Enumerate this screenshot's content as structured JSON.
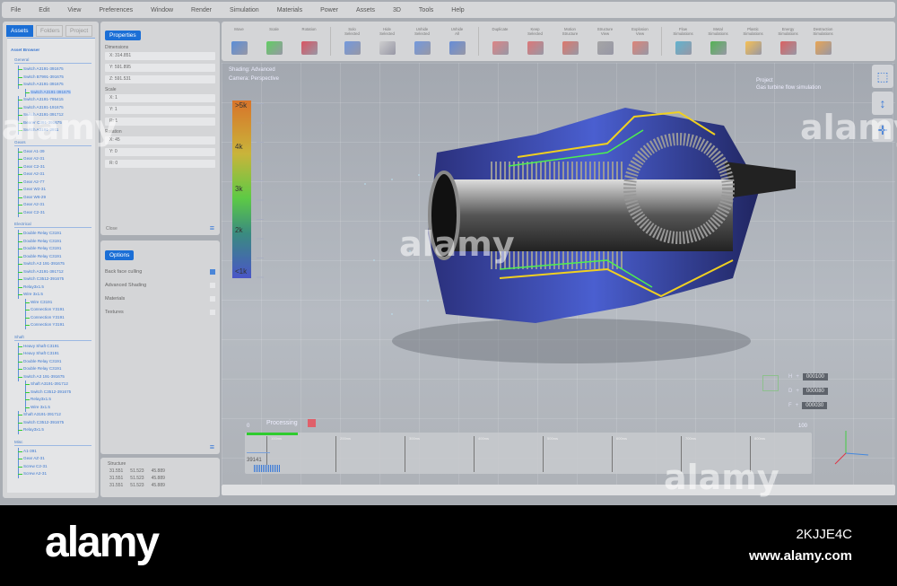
{
  "menu": [
    "File",
    "Edit",
    "View",
    "Preferences",
    "Window",
    "Render",
    "Simulation",
    "Materials",
    "Power",
    "Assets",
    "3D",
    "Tools",
    "Help"
  ],
  "left_tabs": [
    "Assets",
    "Folders",
    "Project"
  ],
  "asset_browser": {
    "title": "Asset Browser",
    "groups": [
      {
        "name": "General",
        "items": [
          {
            "t": "Switch A3191-391675"
          },
          {
            "t": "Switch B7991-391675"
          },
          {
            "t": "Switch A3191-391675"
          },
          {
            "t": "Switch A3191-391675",
            "l2": true,
            "sel": true
          },
          {
            "t": "Switch A3191-795415"
          },
          {
            "t": "Switch A3191-191675"
          },
          {
            "t": "Switch A3191-391712"
          },
          {
            "t": "Bearer C391-391675"
          },
          {
            "t": "Switch A3191-3911"
          }
        ]
      },
      {
        "name": "Gears",
        "items": [
          {
            "t": "Gear A1-39"
          },
          {
            "t": "Gear A2-31"
          },
          {
            "t": "Gear C2-31"
          },
          {
            "t": "Gear A2-31"
          },
          {
            "t": "Gear A2-77"
          },
          {
            "t": "Gear W2-31"
          },
          {
            "t": "Gear W6-29"
          },
          {
            "t": "Gear A2-31"
          },
          {
            "t": "Gear C2-31"
          }
        ]
      },
      {
        "name": "Electrical",
        "items": [
          {
            "t": "Double Relay C3191"
          },
          {
            "t": "Double Relay C3191"
          },
          {
            "t": "Double Relay C3191"
          },
          {
            "t": "Double Relay C3191"
          },
          {
            "t": "Switch A3 191-391675"
          },
          {
            "t": "Switch A3191-391712"
          },
          {
            "t": "Switch C3512-391675"
          },
          {
            "t": "Relay3x1.5"
          },
          {
            "t": "Wire 3x1.5"
          },
          {
            "t": "Wire C3191",
            "l2": true
          },
          {
            "t": "Connection Y3191",
            "l2": true
          },
          {
            "t": "Connection Y3191",
            "l2": true
          },
          {
            "t": "Connection Y3191",
            "l2": true
          }
        ]
      },
      {
        "name": "Shaft",
        "items": [
          {
            "t": "Heavy Shaft C3191"
          },
          {
            "t": "Heavy Shaft C3191"
          },
          {
            "t": "Double Relay C3191"
          },
          {
            "t": "Double Relay C3191"
          },
          {
            "t": "Switch A3 191-391675"
          },
          {
            "t": "Shaft A3191-391712",
            "l2": true
          },
          {
            "t": "Switch C3512-391675",
            "l2": true
          },
          {
            "t": "Relay3x1.5",
            "l2": true
          },
          {
            "t": "Wire 3x1.5",
            "l2": true
          },
          {
            "t": "Shaft A3191-391712"
          },
          {
            "t": "Switch C3512-391675"
          },
          {
            "t": "Relay3x1.5"
          }
        ]
      },
      {
        "name": "Misc",
        "items": [
          {
            "t": "A1-391"
          },
          {
            "t": "Gear AZ-31"
          },
          {
            "t": "Screw C2-31"
          },
          {
            "t": "Screw A2-31"
          }
        ]
      }
    ]
  },
  "properties": {
    "title": "Properties",
    "sections": [
      {
        "label": "Dimensions",
        "fields": [
          "X: 314.851",
          "Y: 591.895",
          "Z: 591.531"
        ]
      },
      {
        "label": "Scale",
        "fields": [
          "X: 1",
          "Y: 1",
          "R: 1"
        ]
      },
      {
        "label": "Rotation",
        "fields": [
          "X: 45",
          "Y: 0",
          "R: 0"
        ]
      }
    ],
    "close": "Close"
  },
  "options": {
    "title": "Options",
    "items": [
      {
        "label": "Back face culling",
        "checked": true
      },
      {
        "label": "Advanced Shading",
        "checked": false
      },
      {
        "label": "Materials",
        "checked": false
      },
      {
        "label": "Textures",
        "checked": false
      }
    ]
  },
  "structure": {
    "title": "Structure",
    "rows": [
      [
        "31.551",
        "51.523",
        "45.889"
      ],
      [
        "31.551",
        "51.523",
        "45.889"
      ],
      [
        "31.551",
        "51.523",
        "45.889"
      ]
    ]
  },
  "toolbar": [
    [
      "Move"
    ],
    [
      "Scale"
    ],
    [
      "Rotation"
    ],
    "|",
    [
      "Solo",
      "Selected"
    ],
    [
      "Hide",
      "Selected"
    ],
    [
      "Unhide",
      "Selected"
    ],
    [
      "Unhide",
      "All"
    ],
    "|",
    [
      "Duplicate"
    ],
    [
      "Keep",
      "Selected"
    ],
    [
      "Motion",
      "Structure"
    ],
    [
      "Structure",
      "View"
    ],
    [
      "Explosion",
      "View"
    ],
    "|",
    [
      "Flow",
      "Simulations"
    ],
    [
      "Metal",
      "Simulations"
    ],
    [
      "Plastic",
      "Simulations"
    ],
    [
      "Energy",
      "Simulations"
    ],
    [
      "Destruction",
      "Simulations"
    ]
  ],
  "viewport": {
    "shading": "Shading: Advanced",
    "camera": "Camera: Perspective",
    "project_label": "Project",
    "project_name": "Gas turbine flow simulation",
    "legend": [
      ">5k",
      "4k",
      "3k",
      "2k",
      "<1k"
    ],
    "coords": [
      {
        "k": "H",
        "v": "000100"
      },
      {
        "k": "D",
        "v": "000080"
      },
      {
        "k": "F",
        "v": "000030"
      }
    ],
    "processing": "Processing",
    "progress_min": "0",
    "progress_max": "100",
    "progress_value": 9,
    "timeline_marks": [
      "100ms",
      "200ms",
      "300ms",
      "400ms",
      "500ms",
      "600ms",
      "700ms",
      "800ms"
    ],
    "counter": "39141"
  },
  "watermark": {
    "brand": "alamy",
    "image_id": "2KJJE4C",
    "url": "www.alamy.com"
  },
  "colors": {
    "accent": "#1b6fd6",
    "progress": "#2ecc2e"
  }
}
